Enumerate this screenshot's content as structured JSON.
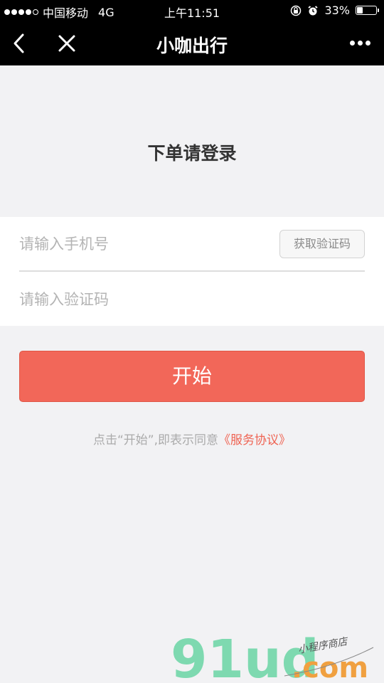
{
  "status_bar": {
    "carrier": "中国移动",
    "network": "4G",
    "time": "上午11:51",
    "battery_text": "33%",
    "battery_level": 0.33,
    "signal_bars": 4
  },
  "nav": {
    "title": "小咖出行"
  },
  "heading": "下单请登录",
  "form": {
    "phone_placeholder": "请输入手机号",
    "get_code_label": "获取验证码",
    "code_placeholder": "请输入验证码"
  },
  "start_button_label": "开始",
  "agreement": {
    "prefix": "点击“开始”,即表示同意",
    "link": "《服务协议》"
  },
  "watermark": {
    "logo_text": "91ud",
    "domain": ".com",
    "tagline": "小程序商店"
  },
  "colors": {
    "accent": "#f26759",
    "link": "#ef6352",
    "background": "#f2f2f4",
    "watermark_green": "#7ed9b0",
    "watermark_orange": "#f0a040"
  }
}
